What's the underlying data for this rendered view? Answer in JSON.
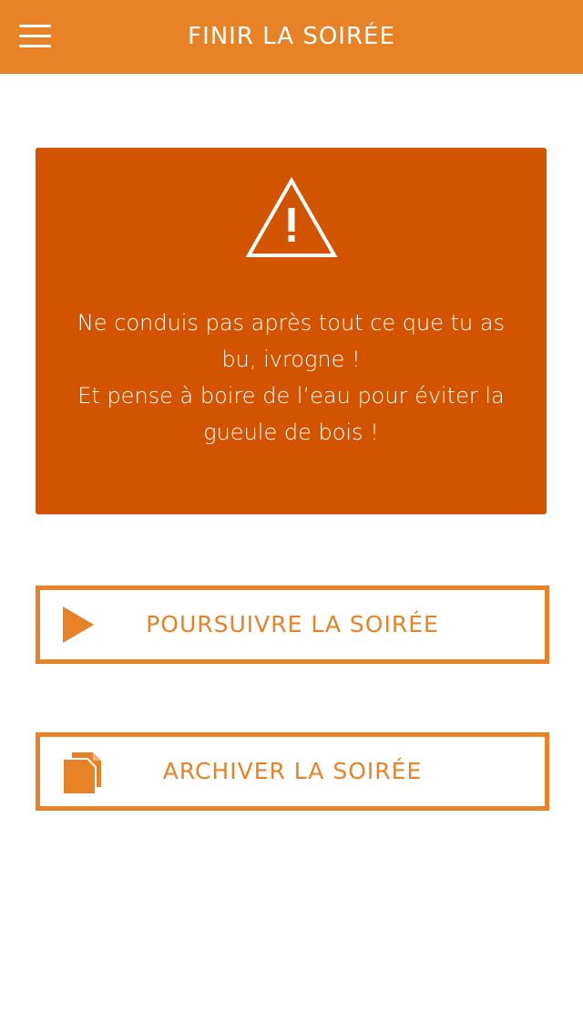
{
  "header": {
    "title": "FINIR LA SOIRÉE",
    "menu_icon": "hamburger-menu-icon"
  },
  "warning": {
    "icon": "warning-triangle-icon",
    "lines": [
      "Ne conduis pas après tout ce que tu as",
      "bu, ivrogne !",
      "Et pense à boire de l’eau pour éviter la",
      "gueule de bois !"
    ]
  },
  "actions": {
    "continue": {
      "label": "POURSUIVRE LA SOIRÉE",
      "icon": "play-icon"
    },
    "archive": {
      "label": "ARCHIVER LA SOIRÉE",
      "icon": "documents-icon"
    }
  },
  "colors": {
    "accent": "#E88227",
    "warning_bg": "#D35400",
    "text_on_accent": "#FFFFFF",
    "background": "#FFFFFF"
  }
}
